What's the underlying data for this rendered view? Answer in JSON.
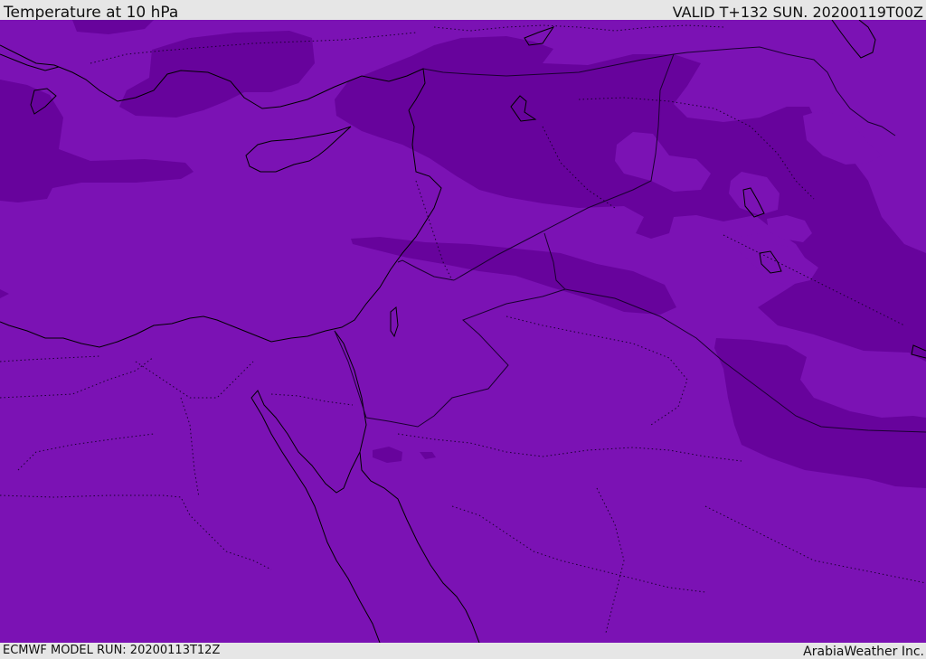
{
  "header": {
    "title": "Temperature at 10 hPa",
    "valid": "VALID T+132 SUN. 20200119T00Z"
  },
  "footer": {
    "model_run": "ECMWF MODEL RUN: 20200113T12Z",
    "credit": "ArabiaWeather Inc."
  },
  "map": {
    "base_color": "#7b12b4",
    "dark_color": "#67039c",
    "coastline_color": "#000000",
    "border_color": "#1a0030"
  }
}
